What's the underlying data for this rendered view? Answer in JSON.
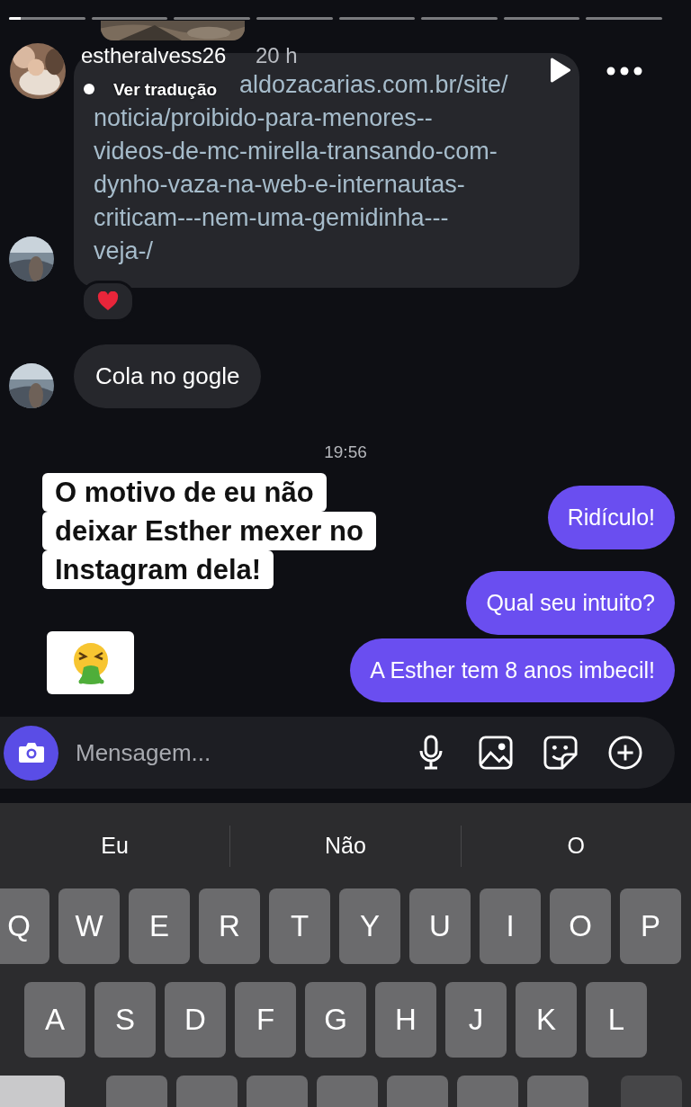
{
  "story_progress": {
    "level": 0.15
  },
  "header": {
    "username": "estheralvess26",
    "time": "20 h",
    "translate_label": "Ver tradução"
  },
  "messages": [
    {
      "kind": "link",
      "lines": [
        "aldozacarias.com.br/site/",
        "noticia/proibido-para-menores--",
        "videos-de-mc-mirella-transando-com-",
        "dynho-vaza-na-web-e-internautas-",
        "criticam---nem-uma-gemidinha---",
        "veja-/"
      ],
      "reaction": true
    },
    {
      "kind": "text",
      "text": "Cola no gogle"
    }
  ],
  "timestamp": "19:56",
  "caption_lines": [
    "O motivo de eu não",
    "deixar Esther mexer no",
    "Instagram dela!"
  ],
  "sent": [
    {
      "text": "Ridículo!"
    },
    {
      "text": "Qual seu intuito?"
    },
    {
      "text": "A Esther tem 8 anos imbecil!"
    }
  ],
  "composer": {
    "placeholder": "Mensagem..."
  },
  "keyboard": {
    "suggestions": [
      "Eu",
      "Não",
      "O"
    ],
    "rows": [
      [
        "Q",
        "W",
        "E",
        "R",
        "T",
        "Y",
        "U",
        "I",
        "O",
        "P"
      ],
      [
        "A",
        "S",
        "D",
        "F",
        "G",
        "H",
        "J",
        "K",
        "L"
      ]
    ]
  }
}
